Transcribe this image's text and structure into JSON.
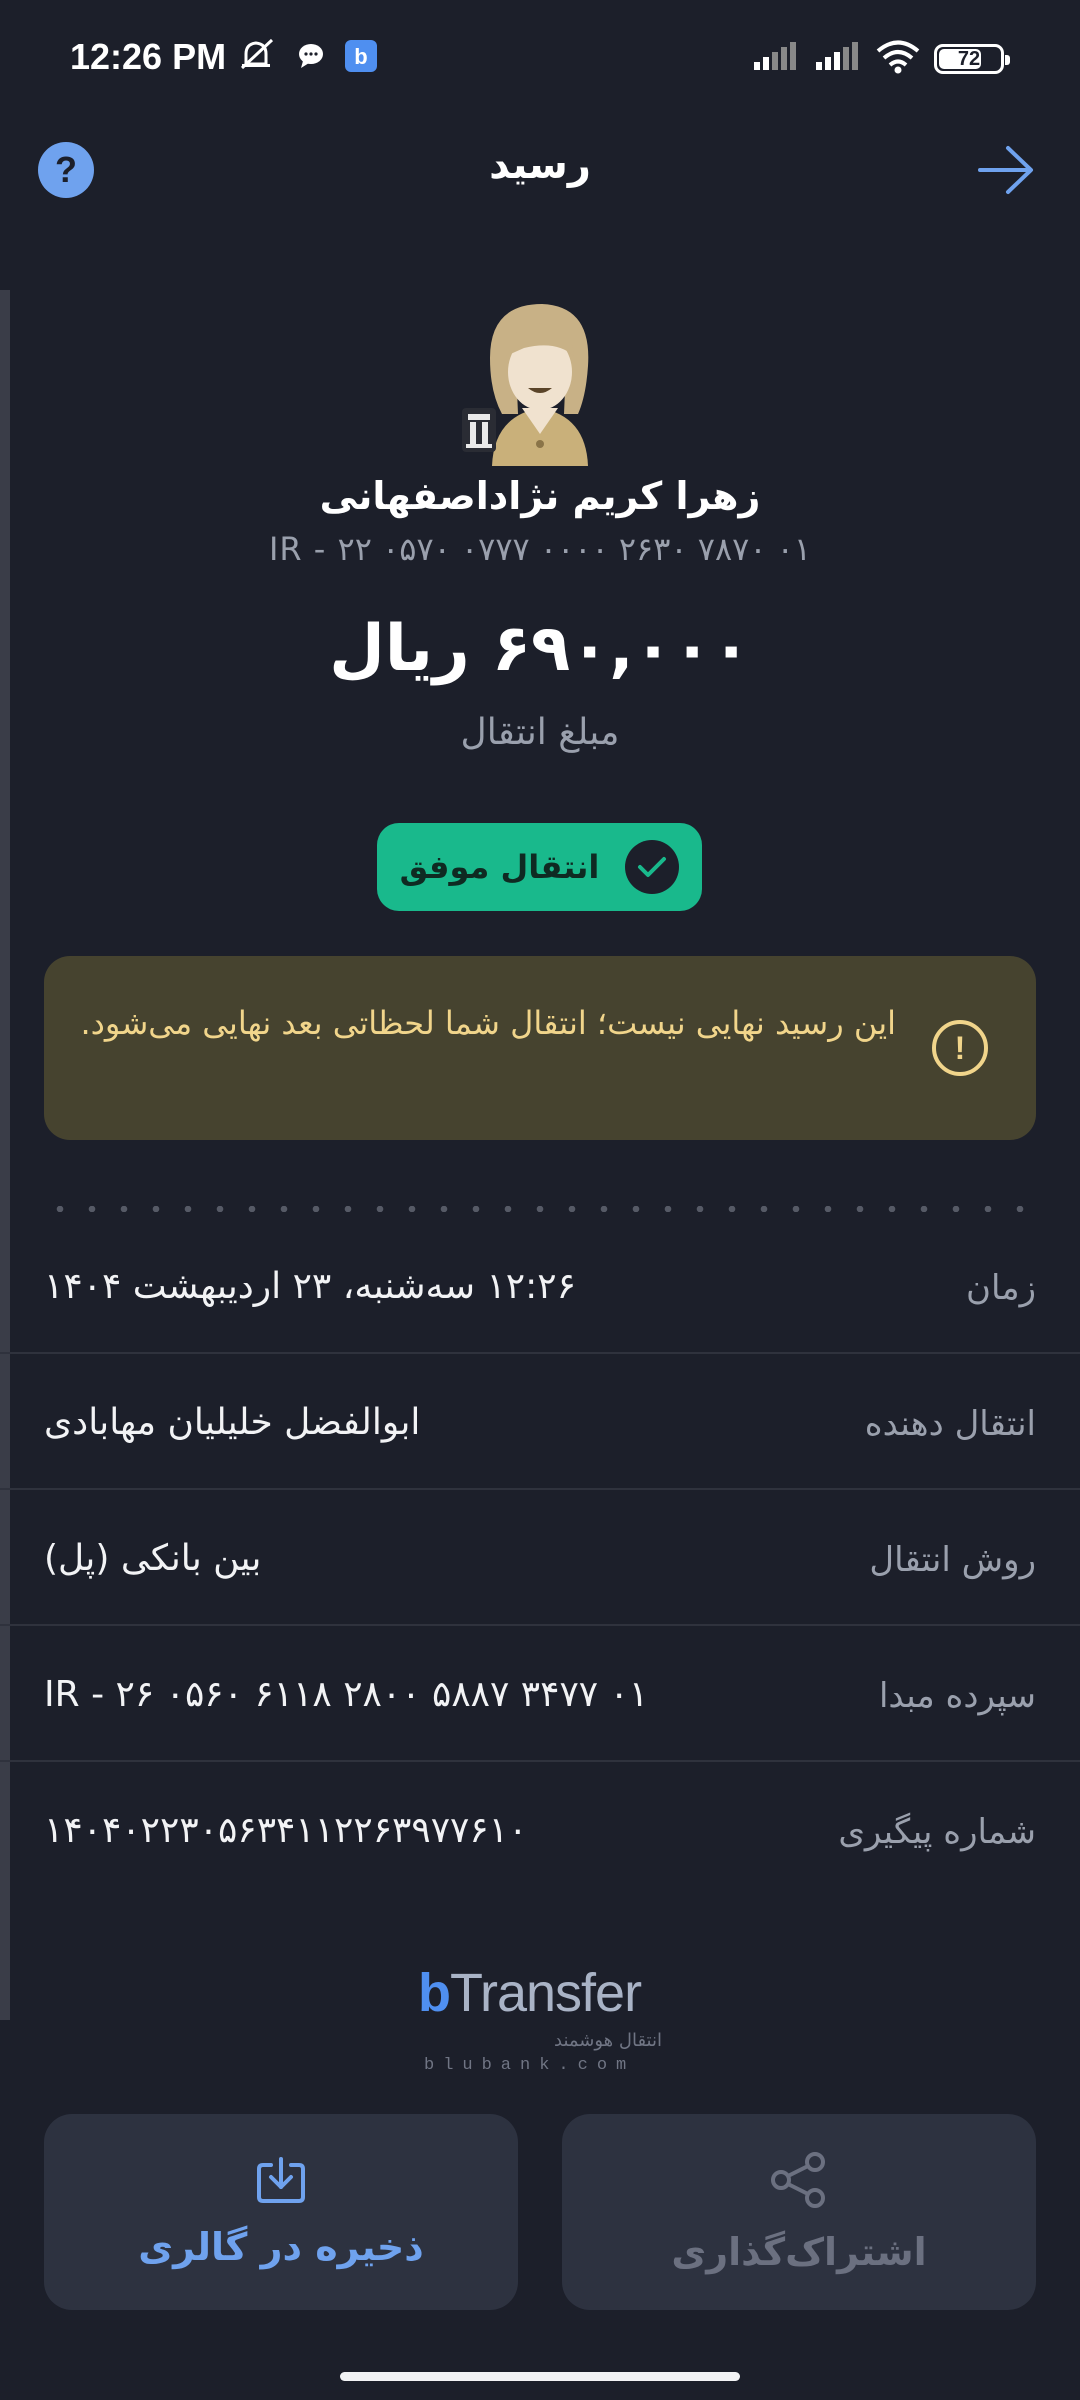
{
  "status_bar": {
    "time": "12:26 PM",
    "battery_level": 72,
    "battery_text": "72",
    "icons": [
      "mute-icon",
      "chat-bubble-icon",
      "blu-app-icon",
      "signal-icon",
      "signal-icon",
      "wifi-icon",
      "battery-icon"
    ]
  },
  "header": {
    "title": "رسید",
    "help_label": "?"
  },
  "recipient": {
    "name": "زهرا کریم نژاداصفهانی",
    "iban": "IR - ۲۲ ۰۵۷۰ ۰۷۷۷ ۰۰۰۰ ۲۶۳۰ ۷۸۷۰ ۰۱"
  },
  "amount": {
    "value": "۶۹۰,۰۰۰ ریال",
    "label": "مبلغ انتقال"
  },
  "status": {
    "label": "انتقال موفق",
    "color": "#19b98c"
  },
  "warning": {
    "text": "این رسید نهایی نیست؛ انتقال شما لحظاتی بعد نهایی می‌شود.",
    "icon_label": "!",
    "color": "#f1d58b"
  },
  "details": [
    {
      "label": "زمان",
      "value": "۱۲:۲۶ سه‌شنبه، ۲۳ اردیبهشت ۱۴۰۴"
    },
    {
      "label": "انتقال دهنده",
      "value": "ابوالفضل خلیلیان مهابادی"
    },
    {
      "label": "روش انتقال",
      "value": "بین بانکی (پل)"
    },
    {
      "label": "سپرده مبدا",
      "value": "IR - ۲۶ ۰۵۶۰ ۶۱۱۸ ۲۸۰۰ ۵۸۸۷ ۳۴۷۷ ۰۱"
    },
    {
      "label": "شماره پیگیری",
      "value": "۱۴۰۴۰۲۲۳۰۵۶۳۴۱۱۲۲۶۳۹۷۷۶۱۰"
    }
  ],
  "brand": {
    "logo_b": "b",
    "logo_rest": "Transfer",
    "tagline": "انتقال هوشمند",
    "domain": "blubank.com"
  },
  "actions": {
    "save_label": "ذخیره در گالری",
    "share_label": "اشتراک‌گذاری"
  },
  "colors": {
    "background": "#1c1f2a",
    "accent": "#6fa2ee",
    "success": "#19b98c",
    "warning_bg": "#46432f"
  }
}
